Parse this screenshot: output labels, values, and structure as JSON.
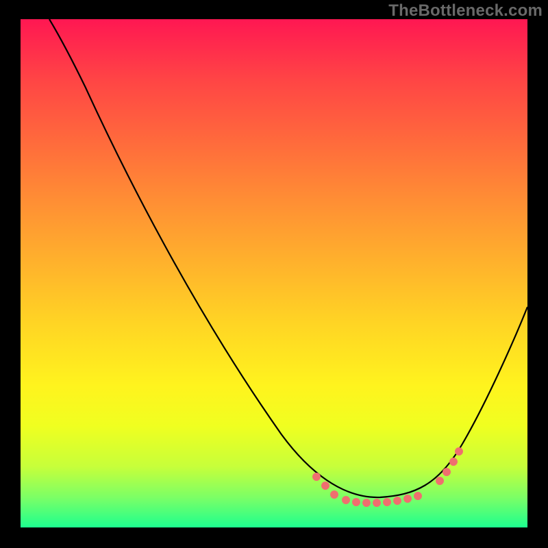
{
  "watermark": "TheBottleneck.com",
  "colors": {
    "curve": "#000000",
    "markers": "#ef6f6f",
    "gradient_top": "#ff1752",
    "gradient_bottom": "#1dff8f",
    "frame_background": "#000000"
  },
  "chart_data": {
    "type": "line",
    "title": "",
    "xlabel": "",
    "ylabel": "",
    "xlim": [
      0,
      100
    ],
    "ylim": [
      0,
      100
    ],
    "grid": false,
    "legend": false,
    "series": [
      {
        "name": "bottleneck-curve",
        "x": [
          6,
          13,
          20,
          34,
          51,
          58,
          64,
          71,
          78,
          87,
          97,
          100
        ],
        "y": [
          100,
          87,
          78,
          58,
          18,
          11,
          6,
          6,
          7,
          16,
          37,
          43
        ]
      }
    ],
    "markers": [
      {
        "name": "highlighted-range",
        "x": [
          58,
          60,
          62,
          64,
          66,
          68,
          70,
          72,
          74,
          76,
          78,
          83,
          84,
          85,
          87
        ],
        "y": [
          11,
          9,
          7,
          6,
          5.8,
          5.7,
          5.7,
          5.8,
          6,
          6.3,
          7,
          10,
          12,
          14,
          16
        ]
      }
    ],
    "background_gradient": "vertical red→yellow→green (heatmap style)"
  }
}
